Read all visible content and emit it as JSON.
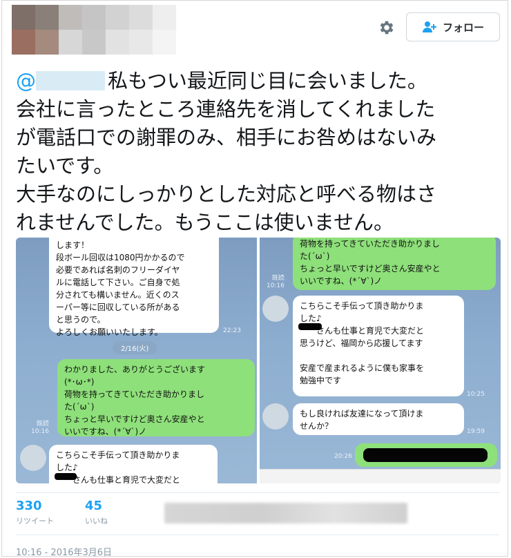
{
  "header": {
    "follow_label": "フォロー",
    "avatar_colors": [
      "#7e6f68",
      "#8a8079",
      "#c0bcb9",
      "#c6c5c5",
      "#d2d2d2",
      "#dcdcdc",
      "#eeeeee",
      "#9a6e60",
      "#a58a7e",
      "#d7d7d7",
      "#c8c8c8",
      "#e2e2e2",
      "#e8e8e8",
      "#f4f4f4"
    ]
  },
  "tweet": {
    "mention_prefix": "@",
    "lines": [
      "私もつい最近同じ目に会いました。",
      "会社に言ったところ連絡先を消してくれました",
      "が電話口での謝罪のみ、相手にお咎めはないみ",
      "たいです。",
      "大手なのにしっかりとした対応と呼べる物はさ",
      "れませんでした。もうここは使いません。"
    ]
  },
  "media": {
    "left": {
      "top_bubble": "します！\n段ボール回収は1080円かかるので\n必要であれば名刺のフリーダイヤ\nルに電話して下さい。ご自身で処\n分されても構いません。近くのス\nーパー等に回収している所がある\nと思うので。\nよろしくお願いいたします。",
      "top_time": "22:23",
      "date_chip": "2/16(火)",
      "green_bubble": "わかりました、ありがとうございます\n(*･ω･*)\n荷物を持ってきていただき助かりまし\nた(ˊωˋ)\nちょっと早いですけど奥さん安産やと\nいいですね、(*´∀`)ノ",
      "read_label": "既読",
      "read_time": "10:16",
      "bottom_bubble": "こちらこそ手伝って頂き助かりま\nした♪\n　　さんも仕事と育児で大変だと"
    },
    "right": {
      "green_bubble": "荷物を持ってきていただき助かりまし\nた(ˊωˋ)\nちょっと早いですけど奥さん安産やと\nいいですね、(*´∀`)ノ",
      "read_label": "既読",
      "read_time": "10:16",
      "bubble_1": "こちらこそ手伝って頂き助かりま\nした♪\n　　さんも仕事と育児で大変だと\n思うけど、福岡から応援してます\n\n安産で産まれるように僕も家事を\n勉強中です",
      "bubble_1_time": "10:25",
      "bubble_2": "もし良ければ友達になって頂けま\nせんか？",
      "bubble_2_time": "19:59",
      "last_time": "20:26"
    }
  },
  "stats": {
    "retweets": "330",
    "retweets_label": "リツイート",
    "likes": "45",
    "likes_label": "いいね"
  },
  "timestamp": "10:16 - 2016年3月6日"
}
